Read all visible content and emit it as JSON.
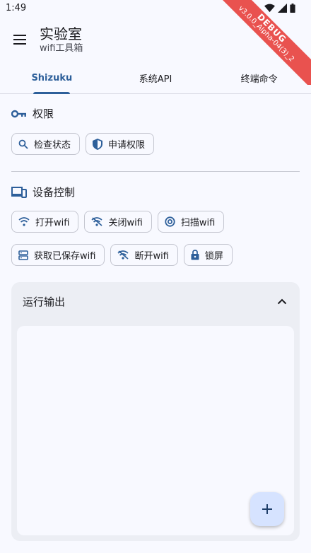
{
  "status_bar": {
    "time": "1:49"
  },
  "debug_banner": {
    "label": "DEBUG",
    "version": "v3.0.0_Alpha-04(3)_2"
  },
  "app_bar": {
    "title": "实验室",
    "subtitle": "wifi工具箱"
  },
  "tabs": [
    {
      "label": "Shizuku",
      "active": true
    },
    {
      "label": "系统API",
      "active": false
    },
    {
      "label": "终端命令",
      "active": false
    }
  ],
  "permission_section": {
    "title": "权限",
    "buttons": [
      {
        "label": "检查状态",
        "icon": "search-icon"
      },
      {
        "label": "申请权限",
        "icon": "shield-icon"
      }
    ]
  },
  "device_section": {
    "title": "设备控制",
    "row1": [
      {
        "label": "打开wifi",
        "icon": "wifi-icon"
      },
      {
        "label": "关闭wifi",
        "icon": "wifi-off-icon"
      },
      {
        "label": "扫描wifi",
        "icon": "wifi-scan-icon"
      }
    ],
    "row2": [
      {
        "label": "获取已保存wifi",
        "icon": "storage-icon"
      },
      {
        "label": "断开wifi",
        "icon": "wifi-off-icon"
      },
      {
        "label": "锁屏",
        "icon": "lock-icon"
      }
    ]
  },
  "output": {
    "title": "运行输出",
    "expanded": true,
    "content": ""
  },
  "colors": {
    "accent": "#2d5f9a",
    "background": "#f8f9ff",
    "fab": "#d6e3ff"
  }
}
